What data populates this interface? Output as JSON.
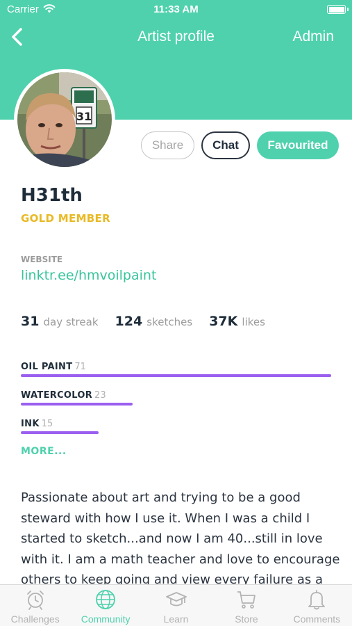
{
  "status_bar": {
    "carrier": "Carrier",
    "time": "11:33 AM"
  },
  "nav": {
    "title": "Artist profile",
    "admin": "Admin"
  },
  "buttons": {
    "share": "Share",
    "chat": "Chat",
    "favourited": "Favourited"
  },
  "profile": {
    "username": "H31th",
    "membership": "GOLD MEMBER"
  },
  "website": {
    "label": "WEBSITE",
    "url": "linktr.ee/hmvoilpaint"
  },
  "stats": [
    {
      "value": "31",
      "label": "day streak"
    },
    {
      "value": "124",
      "label": "sketches"
    },
    {
      "value": "37K",
      "label": "likes"
    }
  ],
  "skills": [
    {
      "name": "OIL PAINT",
      "count": "71",
      "level": 1.0
    },
    {
      "name": "WATERCOLOR",
      "count": "23",
      "level": 0.36
    },
    {
      "name": "INK",
      "count": "15",
      "level": 0.25
    }
  ],
  "more_label": "MORE...",
  "bio": "Passionate about art and trying to be a good steward with how I use it. When I was a child I started to sketch...and now I am 40...still in love with it. I am a math teacher and love to encourage others to keep going and view every failure as a",
  "tabs": [
    {
      "label": "Challenges",
      "icon": "alarm-clock-icon",
      "active": false
    },
    {
      "label": "Community",
      "icon": "globe-icon",
      "active": true
    },
    {
      "label": "Learn",
      "icon": "graduation-cap-icon",
      "active": false
    },
    {
      "label": "Store",
      "icon": "cart-icon",
      "active": false
    },
    {
      "label": "Comments",
      "icon": "bell-icon",
      "active": false
    }
  ],
  "colors": {
    "accent": "#4fd1ad",
    "gold": "#e8b923",
    "skill_bar": "#9b5ff0",
    "text": "#1f2d3a"
  }
}
